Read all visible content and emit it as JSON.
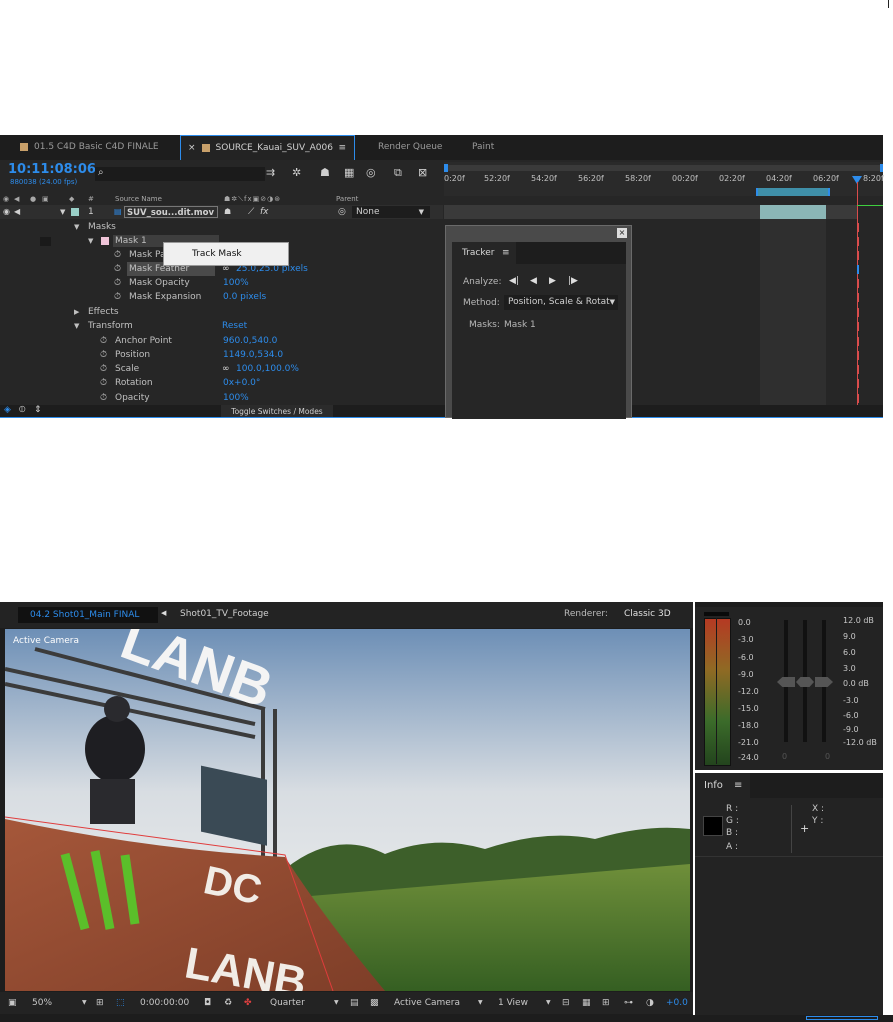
{
  "timeline": {
    "tabs": [
      {
        "label": "01.5 C4D Basic C4D FINALE",
        "swatch": "#c8a06a"
      },
      {
        "label": "SOURCE_Kauai_SUV_A006",
        "swatch": "#c8a06a",
        "close": "×",
        "menu": "≡"
      },
      {
        "label": "Render Queue"
      },
      {
        "label": "Paint"
      }
    ],
    "timecode": "10:11:08:06",
    "frame_info": "880038 (24.00 fps)",
    "search_placeholder": "",
    "columns": {
      "num": "#",
      "source_name": "Source Name",
      "parent": "Parent"
    },
    "ruler_ticks": [
      "0:20f",
      "52:20f",
      "54:20f",
      "56:20f",
      "58:20f",
      "00:20f",
      "02:20f",
      "04:20f",
      "06:20f",
      "8:20f"
    ],
    "layer": {
      "index": "1",
      "name": "SUV_sou...dit.mov",
      "parent_value": "None"
    },
    "rows": [
      {
        "label": "Masks",
        "value": ""
      },
      {
        "label": "Mask 1",
        "value": ""
      },
      {
        "label": "Mask Path",
        "value": ""
      },
      {
        "label": "Mask Feather",
        "value": "25.0,25.0 pixels"
      },
      {
        "label": "Mask Opacity",
        "value": "100%"
      },
      {
        "label": "Mask Expansion",
        "value": "0.0 pixels"
      },
      {
        "label": "Effects",
        "value": ""
      },
      {
        "label": "Transform",
        "value": "Reset"
      },
      {
        "label": "Anchor Point",
        "value": "960.0,540.0"
      },
      {
        "label": "Position",
        "value": "1149.0,534.0"
      },
      {
        "label": "Scale",
        "value": "100.0,100.0%"
      },
      {
        "label": "Rotation",
        "value": "0x+0.0°"
      },
      {
        "label": "Opacity",
        "value": "100%"
      }
    ],
    "context_menu": {
      "item": "Track Mask"
    },
    "bottom_toggle": "Toggle Switches / Modes"
  },
  "tracker": {
    "title": "Tracker",
    "menu": "≡",
    "analyze_label": "Analyze:",
    "method_label": "Method:",
    "method_value": "Position, Scale & Rotat",
    "masks_label": "Masks:",
    "masks_value": "Mask 1",
    "close": "×"
  },
  "viewer": {
    "comp_tab": "04.2 Shot01_Main FINAL",
    "breadcrumb": "Shot01_TV_Footage",
    "renderer_label": "Renderer:",
    "renderer_value": "Classic 3D",
    "camera_label": "Active Camera",
    "scene_text_top": "LANB",
    "scene_text_bottom": "LANB",
    "scene_text_dc": "DC",
    "toolbar": {
      "zoom": "50%",
      "timecode": "0:00:00:00",
      "resolution": "Quarter",
      "camera": "Active Camera",
      "view": "1 View",
      "exposure": "+0.0"
    }
  },
  "audio": {
    "left_labels": [
      "0.0",
      "-3.0",
      "-6.0",
      "-9.0",
      "-12.0",
      "-15.0",
      "-18.0",
      "-21.0",
      "-24.0"
    ],
    "right_labels": [
      "12.0 dB",
      "9.0",
      "6.0",
      "3.0",
      "0.0 dB",
      "-3.0",
      "-6.0",
      "-9.0",
      "-12.0 dB"
    ],
    "slider_zero_a": "0",
    "slider_zero_b": "0"
  },
  "info": {
    "title": "Info",
    "menu": "≡",
    "r": "R :",
    "g": "G :",
    "b": "B :",
    "a": "A :",
    "x": "X :",
    "y": "Y :"
  },
  "colors": {
    "accent": "#2d8ceb",
    "panel": "#232323",
    "keyframe": "#d94c4c"
  }
}
